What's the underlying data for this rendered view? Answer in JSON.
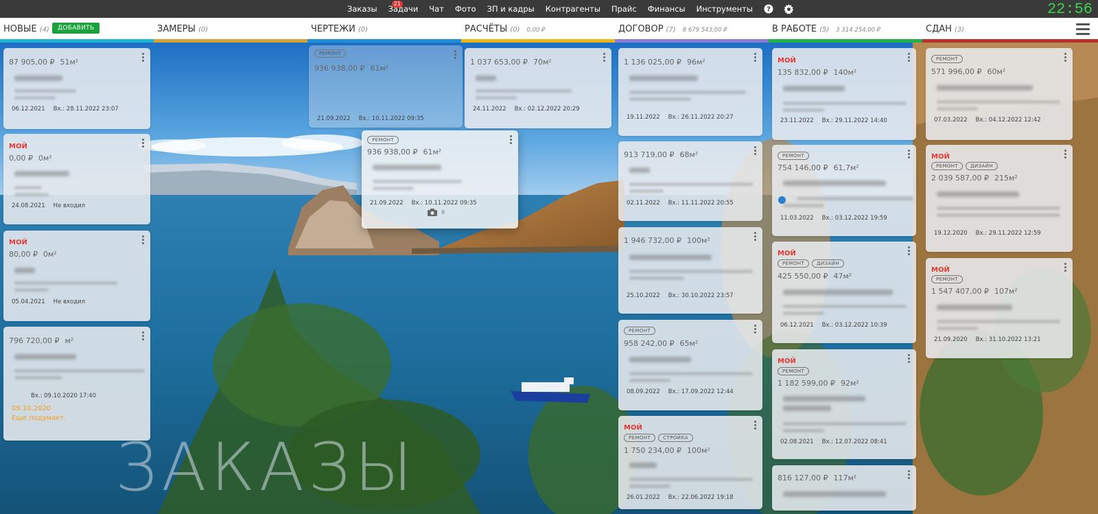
{
  "nav": {
    "items": [
      {
        "label": "Заказы"
      },
      {
        "label": "Задачи",
        "badge": "21"
      },
      {
        "label": "Чат"
      },
      {
        "label": "Фото"
      },
      {
        "label": "ЗП и кадры"
      },
      {
        "label": "Контрагенты"
      },
      {
        "label": "Прайс"
      },
      {
        "label": "Финансы"
      },
      {
        "label": "Инструменты"
      }
    ],
    "help_icon": "question-circle-icon",
    "settings_icon": "gear-icon",
    "clock": "22:56"
  },
  "columns": [
    {
      "title": "НОВЫЕ",
      "count": "(4)",
      "sum": "",
      "color": "#1fb3d6",
      "add_label": "ДОБАВИТЬ"
    },
    {
      "title": "ЗАМЕРЫ",
      "count": "(0)",
      "sum": "",
      "color": "#d9a134"
    },
    {
      "title": "ЧЕРТЕЖИ",
      "count": "(0)",
      "sum": "",
      "color": "#1f8fd9"
    },
    {
      "title": "РАСЧЁТЫ",
      "count": "(0)",
      "sum": "0,00 ₽",
      "color": "#f2b81a"
    },
    {
      "title": "ДОГОВОР",
      "count": "(7)",
      "sum": "8 679 543,00 ₽",
      "color": "#8a7bd6"
    },
    {
      "title": "В РАБОТЕ",
      "count": "(5)",
      "sum": "3 314 254,00 ₽",
      "color": "#22b24c"
    },
    {
      "title": "СДАН",
      "count": "(3)",
      "sum": "",
      "color": "#b8302a"
    }
  ],
  "cards": {
    "new1": {
      "price": "87 905,00 ₽",
      "area": "51м²",
      "date": "06.12.2021",
      "entry": "Вх.: 28.11.2022 23:07"
    },
    "new2": {
      "mine": "МОЙ",
      "price": "0,00 ₽",
      "area": "0м²",
      "date": "24.08.2021",
      "entry": "Не входил"
    },
    "new3": {
      "mine": "МОЙ",
      "price": "80,00 ₽",
      "area": "0м²",
      "date": "05.04.2021",
      "entry": "Не входил"
    },
    "new4": {
      "price": "796 720,00 ₽",
      "area": "м²",
      "date": "",
      "entry": "Вх.: 09.10.2020 17:40",
      "note_date": "09.10.2020",
      "note": "Еще подумает."
    },
    "drawing_ghost": {
      "tag": "РЕМОНТ",
      "price": "936 938,00 ₽",
      "area": "61м²",
      "date": "21.09.2022",
      "entry": "Вх.: 10.11.2022 09:35"
    },
    "drawing_drag": {
      "tag": "РЕМОНТ",
      "price": "936 938,00 ₽",
      "area": "61м²",
      "date": "21.09.2022",
      "entry": "Вх.: 10.11.2022 09:35",
      "photos": "9"
    },
    "calc1": {
      "price": "1 037 653,00 ₽",
      "area": "70м²",
      "date": "24.11.2022",
      "entry": "Вх.: 02.12.2022 20:29"
    },
    "dog1": {
      "price": "1 136 025,00 ₽",
      "area": "96м²",
      "date": "19.11.2022",
      "entry": "Вх.: 26.11.2022 20:27"
    },
    "dog2": {
      "price": "913 719,00 ₽",
      "area": "68м²",
      "date": "02.11.2022",
      "entry": "Вх.: 11.11.2022 20:55"
    },
    "dog3": {
      "price": "1 946 732,00 ₽",
      "area": "100м²",
      "date": "25.10.2022",
      "entry": "Вх.: 30.10.2022 23:57"
    },
    "dog4": {
      "tag": "РЕМОНТ",
      "price": "958 242,00 ₽",
      "area": "65м²",
      "date": "08.09.2022",
      "entry": "Вх.: 17.09.2022 12:44"
    },
    "dog5": {
      "mine": "МОЙ",
      "tag": "РЕМОНТ",
      "tag2": "СТРОЙКА",
      "price": "1 750 234,00 ₽",
      "area": "100м²",
      "date": "26.01.2022",
      "entry": "Вх.: 22.06.2022 19:18"
    },
    "work1": {
      "mine": "МОЙ",
      "price": "135 832,00 ₽",
      "area": "140м²",
      "date": "23.11.2022",
      "entry": "Вх.: 29.11.2022 14:40"
    },
    "work2": {
      "tag": "РЕМОНТ",
      "price": "754 146,00 ₽",
      "area": "61,7м²",
      "date": "11.03.2022",
      "entry": "Вх.: 03.12.2022 19:59"
    },
    "work3": {
      "mine": "МОЙ",
      "tag": "РЕМОНТ",
      "tag2": "ДИЗАЙН",
      "price": "425 550,00 ₽",
      "area": "47м²",
      "date": "06.12.2021",
      "entry": "Вх.: 03.12.2022 10:39"
    },
    "work4": {
      "mine": "МОЙ",
      "tag": "РЕМОНТ",
      "price": "1 182 599,00 ₽",
      "area": "92м²",
      "date": "02.08.2021",
      "entry": "Вх.: 12.07.2022 08:41"
    },
    "work5": {
      "price": "816 127,00 ₽",
      "area": "117м²"
    },
    "done1": {
      "tag": "РЕМОНТ",
      "price": "571 996,00 ₽",
      "area": "60м²",
      "date": "07.03.2022",
      "entry": "Вх.: 04.12.2022 12:42"
    },
    "done2": {
      "mine": "МОЙ",
      "tag": "РЕМОНТ",
      "tag2": "ДИЗАЙН",
      "price": "2 039 587,00 ₽",
      "area": "215м²",
      "date": "19.12.2020",
      "entry": "Вх.: 29.11.2022 12:59"
    },
    "done3": {
      "mine": "МОЙ",
      "tag": "РЕМОНТ",
      "price": "1 547 407,00 ₽",
      "area": "107м²",
      "date": "21.09.2020",
      "entry": "Вх.: 31.10.2022 13:21"
    }
  },
  "watermark": "ЗАКАЗЫ"
}
